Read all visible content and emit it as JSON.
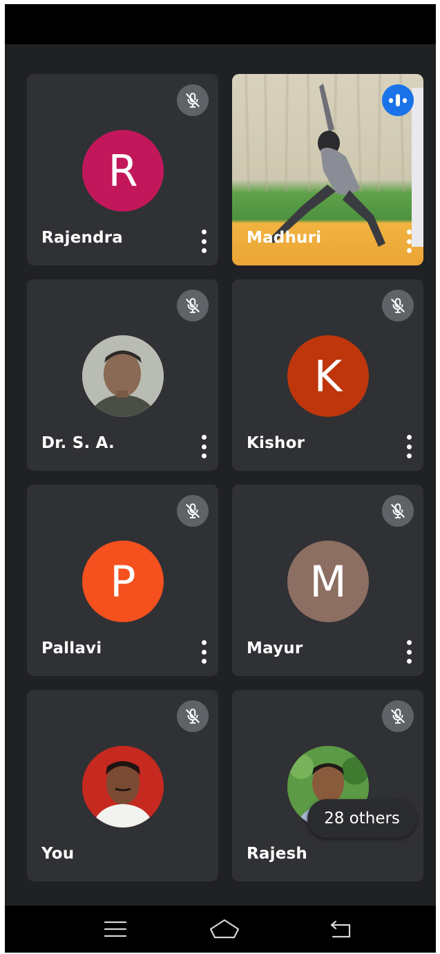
{
  "participants": [
    {
      "name": "Rajendra",
      "initial": "R",
      "color": "#c2185b",
      "type": "initial",
      "muted": true
    },
    {
      "name": "Madhuri",
      "type": "video",
      "speaking": true
    },
    {
      "name": "Dr. S. A.",
      "type": "photo",
      "muted": true
    },
    {
      "name": "Kishor",
      "initial": "K",
      "color": "#bf360c",
      "type": "initial",
      "muted": true
    },
    {
      "name": "Pallavi",
      "initial": "P",
      "color": "#f4511e",
      "type": "initial",
      "muted": true
    },
    {
      "name": "Mayur",
      "initial": "M",
      "color": "#8d6e63",
      "type": "initial",
      "muted": true
    },
    {
      "name": "You",
      "type": "photo",
      "muted": true
    },
    {
      "name": "Rajesh",
      "type": "photo",
      "muted": true
    }
  ],
  "others_label": "28 others",
  "icons": {
    "muted": "mic-off-icon",
    "speaking": "audio-wave-icon",
    "more": "more-vert-icon",
    "nav_recent": "menu-icon",
    "nav_home": "home-icon",
    "nav_back": "back-icon"
  },
  "colors": {
    "background": "#202124",
    "tile": "#303134",
    "accent": "#1a73e8"
  }
}
